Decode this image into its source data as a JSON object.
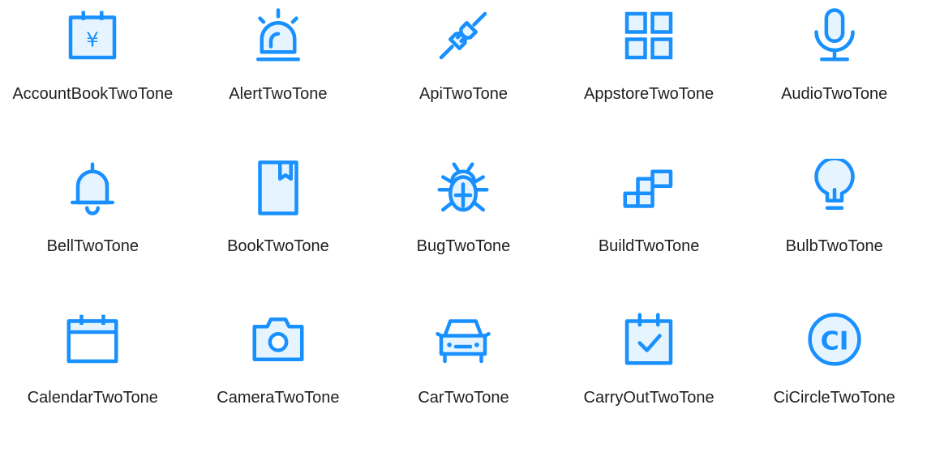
{
  "colors": {
    "primary": "#1890ff",
    "secondary": "#e6f4ff",
    "label": "#1f1f1f",
    "background": "#ffffff"
  },
  "icons": [
    {
      "label": "AccountBookTwoTone",
      "icon": "account-book-icon"
    },
    {
      "label": "AlertTwoTone",
      "icon": "alert-icon"
    },
    {
      "label": "ApiTwoTone",
      "icon": "api-icon"
    },
    {
      "label": "AppstoreTwoTone",
      "icon": "appstore-icon"
    },
    {
      "label": "AudioTwoTone",
      "icon": "audio-icon"
    },
    {
      "label": "BellTwoTone",
      "icon": "bell-icon"
    },
    {
      "label": "BookTwoTone",
      "icon": "book-icon"
    },
    {
      "label": "BugTwoTone",
      "icon": "bug-icon"
    },
    {
      "label": "BuildTwoTone",
      "icon": "build-icon"
    },
    {
      "label": "BulbTwoTone",
      "icon": "bulb-icon"
    },
    {
      "label": "CalendarTwoTone",
      "icon": "calendar-icon"
    },
    {
      "label": "CameraTwoTone",
      "icon": "camera-icon"
    },
    {
      "label": "CarTwoTone",
      "icon": "car-icon"
    },
    {
      "label": "CarryOutTwoTone",
      "icon": "carry-out-icon"
    },
    {
      "label": "CiCircleTwoTone",
      "icon": "ci-circle-icon"
    }
  ]
}
